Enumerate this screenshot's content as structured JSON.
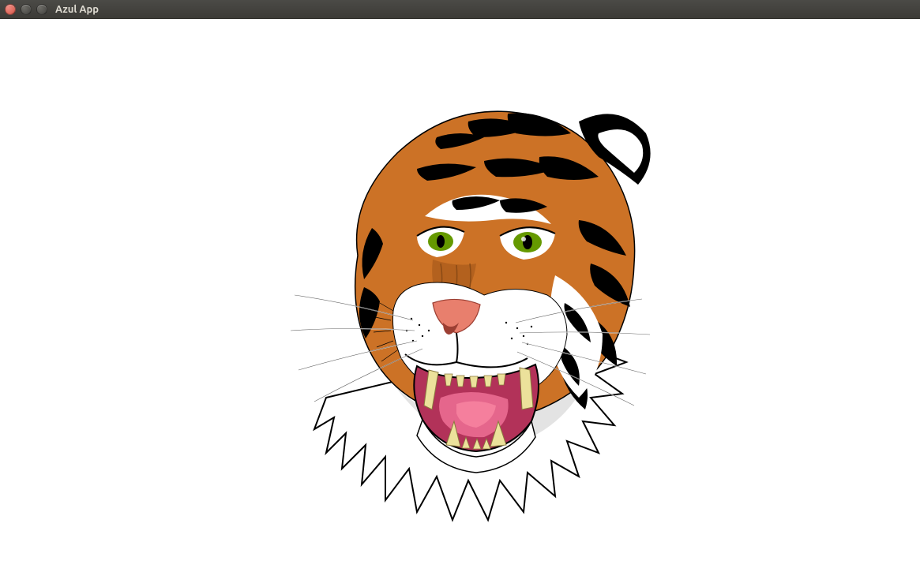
{
  "window": {
    "title": "Azul App",
    "controls": {
      "close_tooltip": "Close",
      "minimize_tooltip": "Minimize",
      "maximize_tooltip": "Maximize"
    }
  },
  "content": {
    "image_name": "tiger-illustration",
    "image_description": "Roaring tiger head vector illustration",
    "colors": {
      "fur_orange": "#cc7226",
      "stripes_black": "#000000",
      "white": "#ffffff",
      "eye_green": "#659900",
      "mouth_pink": "#e5668c",
      "tongue_pink": "#b23259",
      "nose_pink": "#e87f6d",
      "shadow_grey": "#cccccc",
      "teeth_ivory": "#ece19b"
    }
  }
}
